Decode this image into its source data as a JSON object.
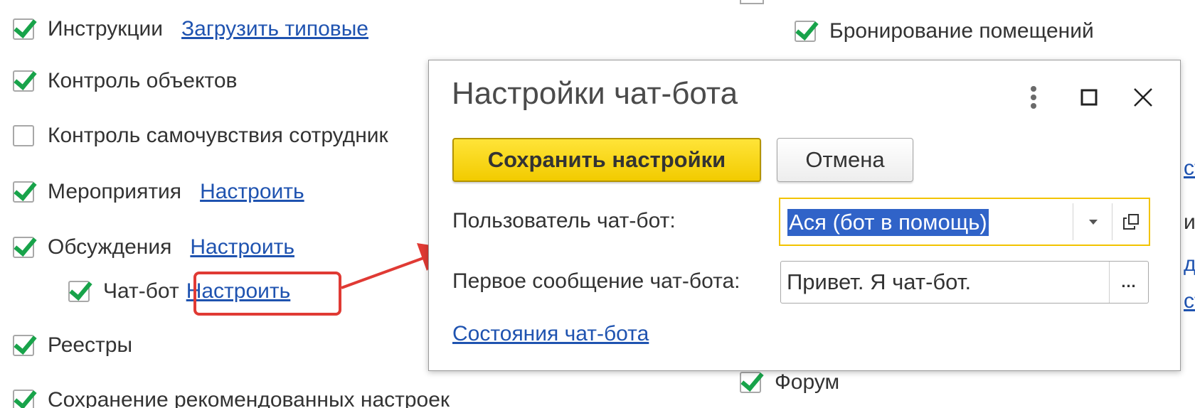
{
  "left_options": [
    {
      "label": "Инструкции",
      "checked": true,
      "link": "Загрузить типовые"
    },
    {
      "label": "Контроль объектов",
      "checked": true,
      "link": ""
    },
    {
      "label": "Контроль самочувствия сотрудник",
      "checked": false,
      "link": ""
    },
    {
      "label": "Мероприятия",
      "checked": true,
      "link": "Настроить"
    },
    {
      "label": "Обсуждения",
      "checked": true,
      "link": "Настроить"
    },
    {
      "label": "Чат-бот",
      "checked": true,
      "link": "Настроить"
    },
    {
      "label": "Реестры",
      "checked": true,
      "link": ""
    },
    {
      "label": "Сохранение рекомендованных настроек",
      "checked": true,
      "link": ""
    }
  ],
  "right_options": [
    {
      "label": "Бронирование помещений",
      "checked": true
    },
    {
      "label": "Форум",
      "checked": true
    }
  ],
  "right_fragments": [
    "ст",
    "им",
    "да",
    "ст"
  ],
  "dialog": {
    "title": "Настройки чат-бота",
    "more_icon": "vertical-dots-icon",
    "maximize_icon": "maximize-icon",
    "close_icon": "close-icon",
    "save_label": "Сохранить настройки",
    "cancel_label": "Отмена",
    "user_label": "Пользователь чат-бот:",
    "user_value": "Ася (бот в помощь)",
    "message_label": "Первое сообщение чат-бота:",
    "message_value": "Привет. Я чат-бот.",
    "message_button": "...",
    "status_link": "Состояния чат-бота"
  },
  "colors": {
    "checkmark": "#18a34a",
    "link": "#1f53b0",
    "save_button": "#f2cb00",
    "focus_border": "#f2c300",
    "selection": "#3063c8",
    "annotation": "#e03a34"
  }
}
